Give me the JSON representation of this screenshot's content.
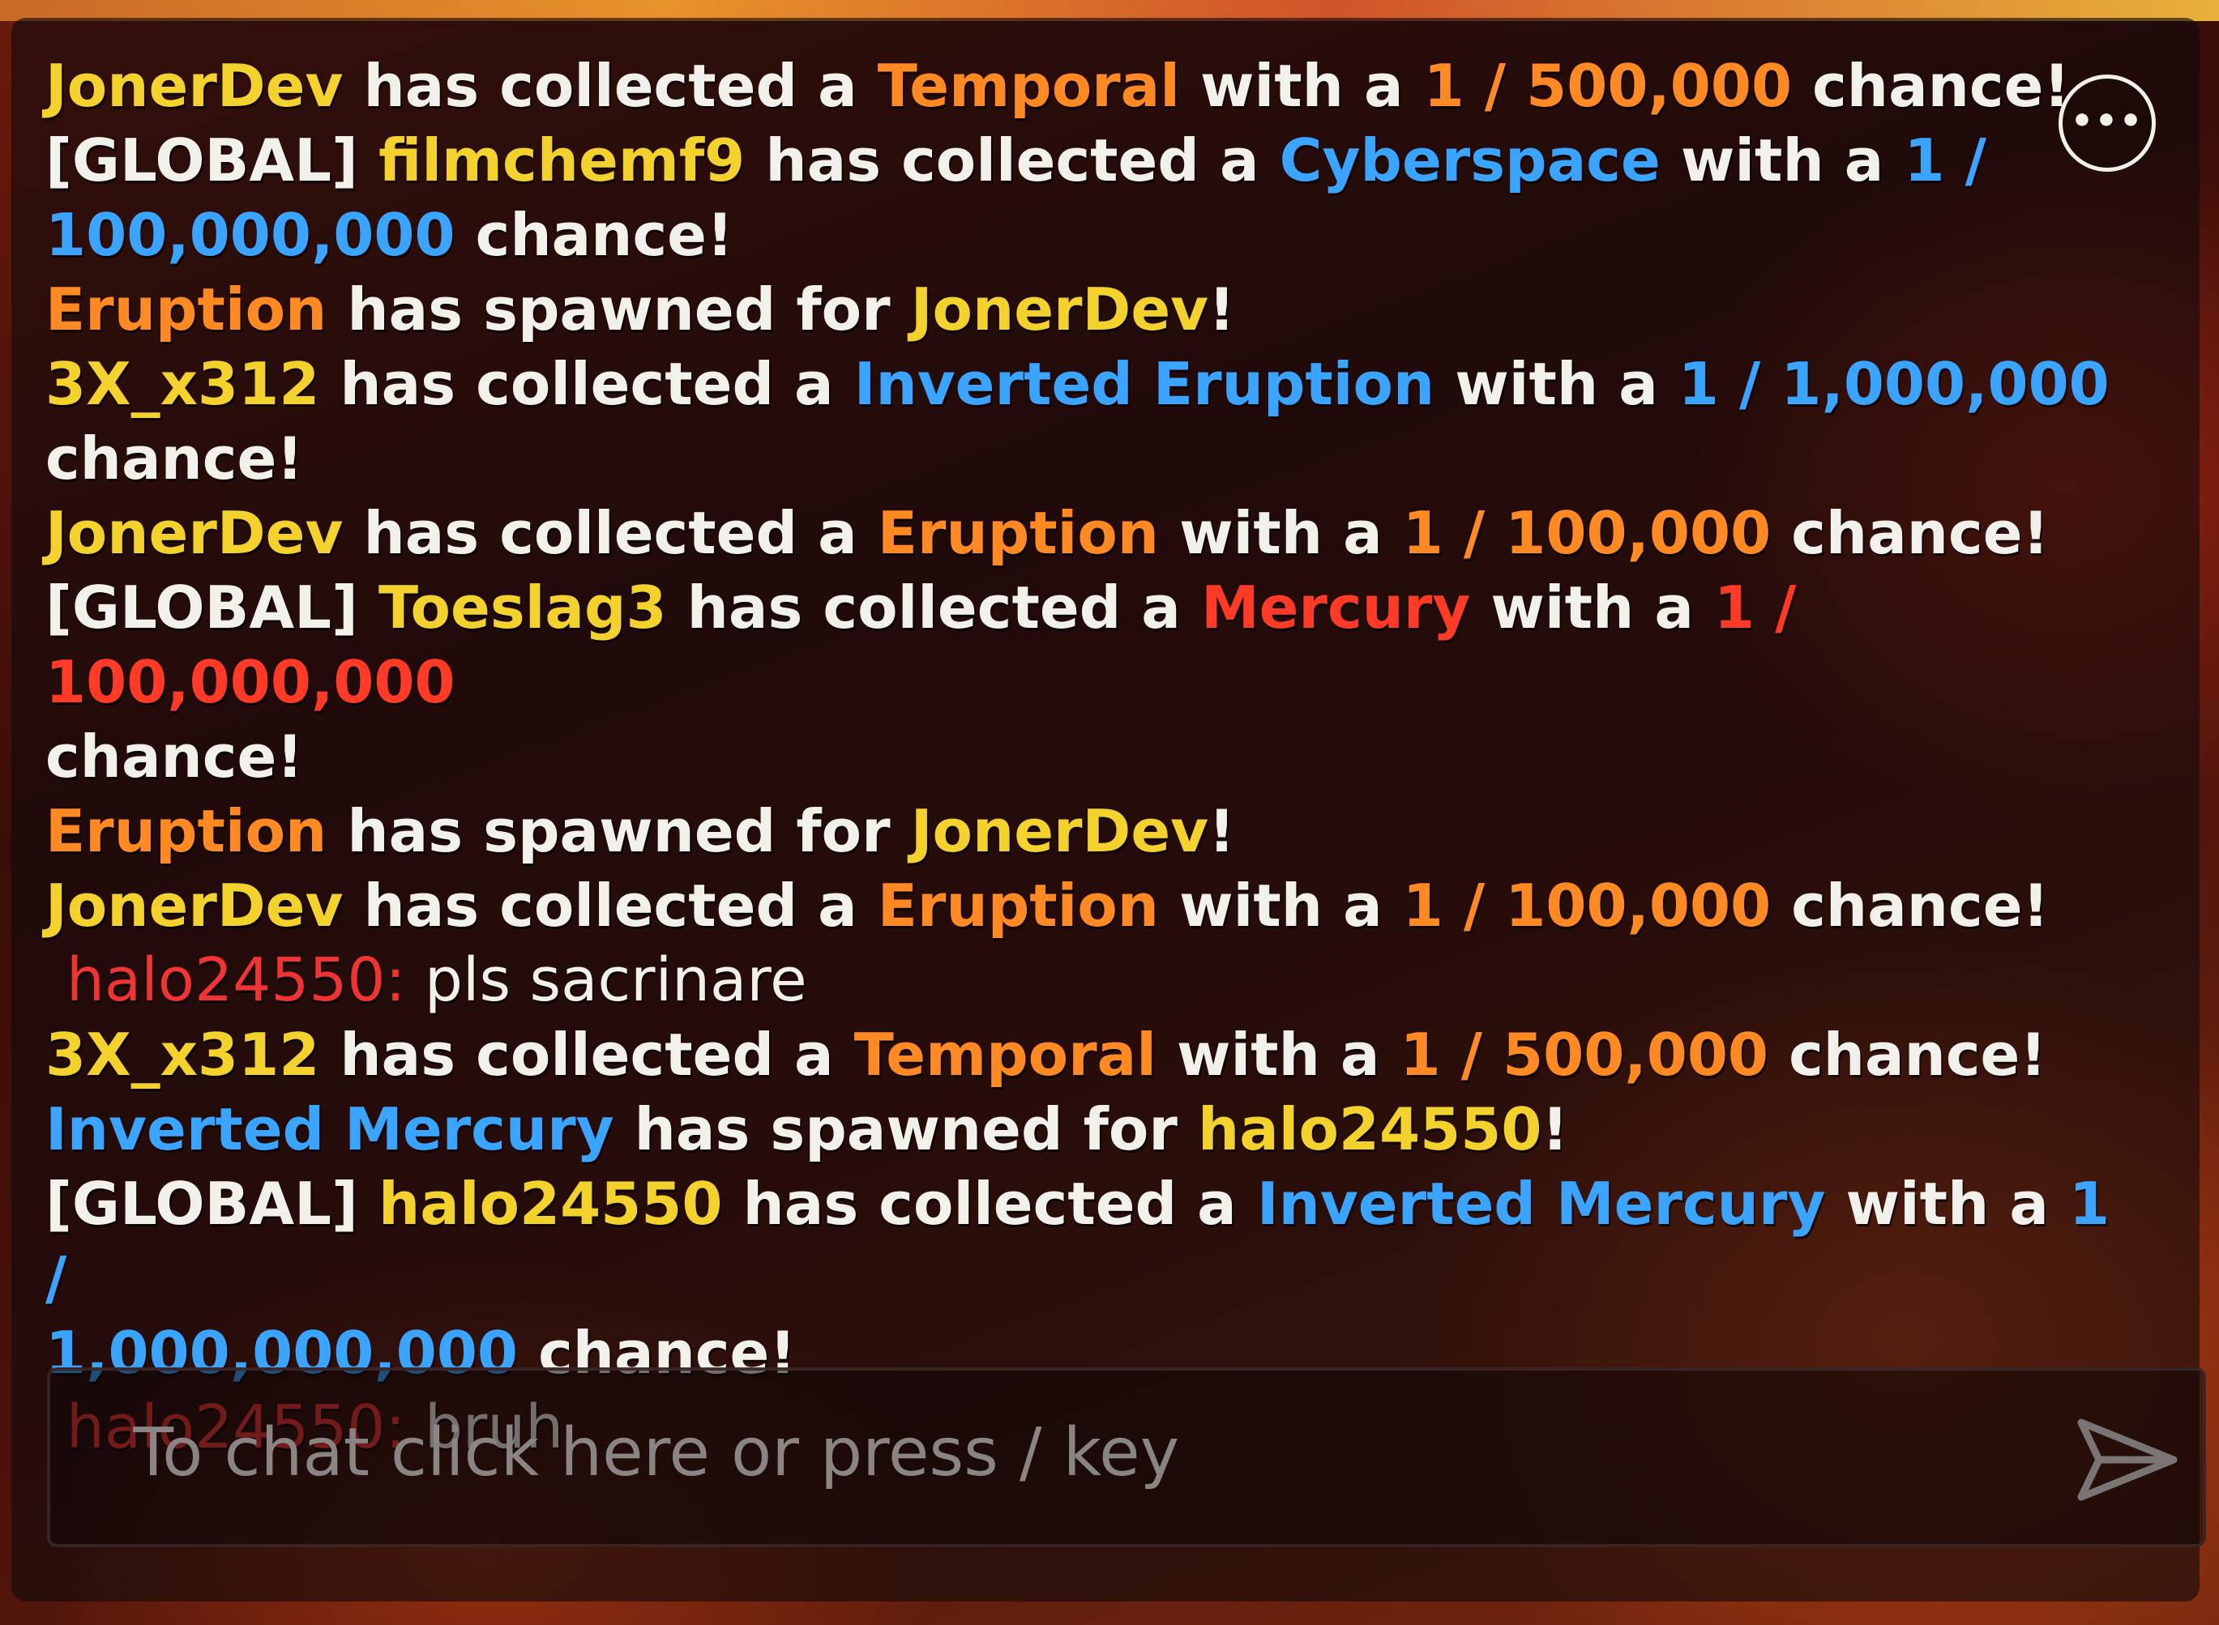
{
  "chat": {
    "messages": [
      {
        "kind": "system",
        "parts": [
          {
            "t": "JonerDev",
            "c": "y"
          },
          {
            "t": " has collected a ",
            "c": "w"
          },
          {
            "t": "Temporal",
            "c": "o"
          },
          {
            "t": " with a ",
            "c": "w"
          },
          {
            "t": "1 / 500,000",
            "c": "o"
          },
          {
            "t": " chance!",
            "c": "w"
          }
        ]
      },
      {
        "kind": "system",
        "parts": [
          {
            "t": "[GLOBAL] ",
            "c": "w"
          },
          {
            "t": "filmchemf9",
            "c": "y"
          },
          {
            "t": " has collected a ",
            "c": "w"
          },
          {
            "t": "Cyberspace",
            "c": "b"
          },
          {
            "t": " with a ",
            "c": "w"
          },
          {
            "t": "1 /",
            "c": "b"
          }
        ]
      },
      {
        "kind": "system",
        "parts": [
          {
            "t": "100,000,000",
            "c": "b"
          },
          {
            "t": " chance!",
            "c": "w"
          }
        ]
      },
      {
        "kind": "system",
        "parts": [
          {
            "t": "Eruption",
            "c": "o"
          },
          {
            "t": " has spawned for ",
            "c": "w"
          },
          {
            "t": "JonerDev",
            "c": "y"
          },
          {
            "t": "!",
            "c": "w"
          }
        ]
      },
      {
        "kind": "system",
        "parts": [
          {
            "t": "3X_x312",
            "c": "y"
          },
          {
            "t": " has collected a ",
            "c": "w"
          },
          {
            "t": "Inverted Eruption",
            "c": "b"
          },
          {
            "t": " with a ",
            "c": "w"
          },
          {
            "t": "1 / 1,000,000",
            "c": "b"
          }
        ]
      },
      {
        "kind": "system",
        "parts": [
          {
            "t": "chance!",
            "c": "w"
          }
        ]
      },
      {
        "kind": "system",
        "parts": [
          {
            "t": "JonerDev",
            "c": "y"
          },
          {
            "t": " has collected a ",
            "c": "w"
          },
          {
            "t": "Eruption",
            "c": "o"
          },
          {
            "t": " with a ",
            "c": "w"
          },
          {
            "t": "1 / 100,000",
            "c": "o"
          },
          {
            "t": " chance!",
            "c": "w"
          }
        ]
      },
      {
        "kind": "system",
        "parts": [
          {
            "t": "[GLOBAL] ",
            "c": "w"
          },
          {
            "t": "Toeslag3",
            "c": "y"
          },
          {
            "t": " has collected a ",
            "c": "w"
          },
          {
            "t": "Mercury",
            "c": "r"
          },
          {
            "t": " with a ",
            "c": "w"
          },
          {
            "t": "1 / 100,000,000",
            "c": "r"
          }
        ]
      },
      {
        "kind": "system",
        "parts": [
          {
            "t": "chance!",
            "c": "w"
          }
        ]
      },
      {
        "kind": "system",
        "parts": [
          {
            "t": "Eruption",
            "c": "o"
          },
          {
            "t": " has spawned for ",
            "c": "w"
          },
          {
            "t": "JonerDev",
            "c": "y"
          },
          {
            "t": "!",
            "c": "w"
          }
        ]
      },
      {
        "kind": "system",
        "parts": [
          {
            "t": "JonerDev",
            "c": "y"
          },
          {
            "t": " has collected a ",
            "c": "w"
          },
          {
            "t": "Eruption",
            "c": "o"
          },
          {
            "t": " with a ",
            "c": "w"
          },
          {
            "t": "1 / 100,000",
            "c": "o"
          },
          {
            "t": " chance!",
            "c": "w"
          }
        ]
      },
      {
        "kind": "user",
        "user": "halo24550:",
        "text": " pls sacrinare"
      },
      {
        "kind": "system",
        "parts": [
          {
            "t": "3X_x312",
            "c": "y"
          },
          {
            "t": " has collected a ",
            "c": "w"
          },
          {
            "t": "Temporal",
            "c": "o"
          },
          {
            "t": " with a ",
            "c": "w"
          },
          {
            "t": "1 / 500,000",
            "c": "o"
          },
          {
            "t": " chance!",
            "c": "w"
          }
        ]
      },
      {
        "kind": "system",
        "parts": [
          {
            "t": "Inverted Mercury",
            "c": "b"
          },
          {
            "t": " has spawned for ",
            "c": "w"
          },
          {
            "t": "halo24550",
            "c": "y"
          },
          {
            "t": "!",
            "c": "w"
          }
        ]
      },
      {
        "kind": "system",
        "parts": [
          {
            "t": "[GLOBAL] ",
            "c": "w"
          },
          {
            "t": "halo24550",
            "c": "y"
          },
          {
            "t": " has collected a ",
            "c": "w"
          },
          {
            "t": "Inverted Mercury",
            "c": "b"
          },
          {
            "t": " with a ",
            "c": "w"
          },
          {
            "t": "1 /",
            "c": "b"
          }
        ]
      },
      {
        "kind": "system",
        "parts": [
          {
            "t": "1,000,000,000",
            "c": "b"
          },
          {
            "t": " chance!",
            "c": "w"
          }
        ]
      },
      {
        "kind": "user",
        "user": "halo24550:",
        "text": " bruh"
      }
    ]
  },
  "menu": {
    "icon": "more-options-icon",
    "glyph": "•••"
  },
  "input": {
    "placeholder": "To chat click here or press / key",
    "value": "",
    "send_icon": "send-arrow-icon"
  },
  "colors": {
    "username": "#f4d22e",
    "orange_rarity": "#ff8a24",
    "blue_rarity": "#3aa4ff",
    "red_rarity": "#ff3a26",
    "chat_username": "#f03434",
    "text": "#f2f0ea",
    "placeholder": "#8a8484"
  }
}
